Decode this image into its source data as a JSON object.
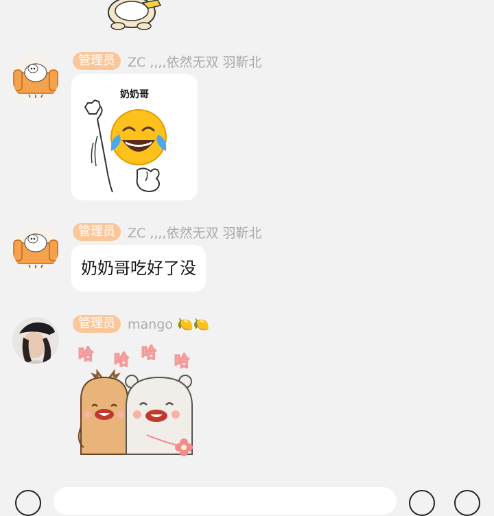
{
  "messages": [
    {
      "badge": "管理员",
      "sender": "ZC ,,,,依然无双 羽靳北",
      "avatar_icon": "sheep-on-orange-couch-avatar",
      "type": "sticker",
      "sticker_caption": "奶奶哥",
      "sticker_icon": "crying-laughing-face-flexing-arm-sticker"
    },
    {
      "badge": "管理员",
      "sender": "ZC ,,,,依然无双 羽靳北",
      "avatar_icon": "sheep-on-orange-couch-avatar",
      "type": "text",
      "text": "奶奶哥吃好了没"
    },
    {
      "badge": "管理员",
      "sender": "mango",
      "sender_emoji": "🍋🍋",
      "avatar_icon": "woman-in-cap-photo-avatar",
      "type": "sticker",
      "sticker_lettering": [
        "哈",
        "哈",
        "哈",
        "哈"
      ],
      "sticker_icon": "deer-and-bear-laughing-sticker"
    }
  ],
  "top_partial_sticker_icon": "sheep-sticker-partial",
  "colors": {
    "background": "#f2f2f2",
    "badge": "#fbc79a",
    "sender_text": "#aaaaaa",
    "bubble": "#ffffff"
  }
}
